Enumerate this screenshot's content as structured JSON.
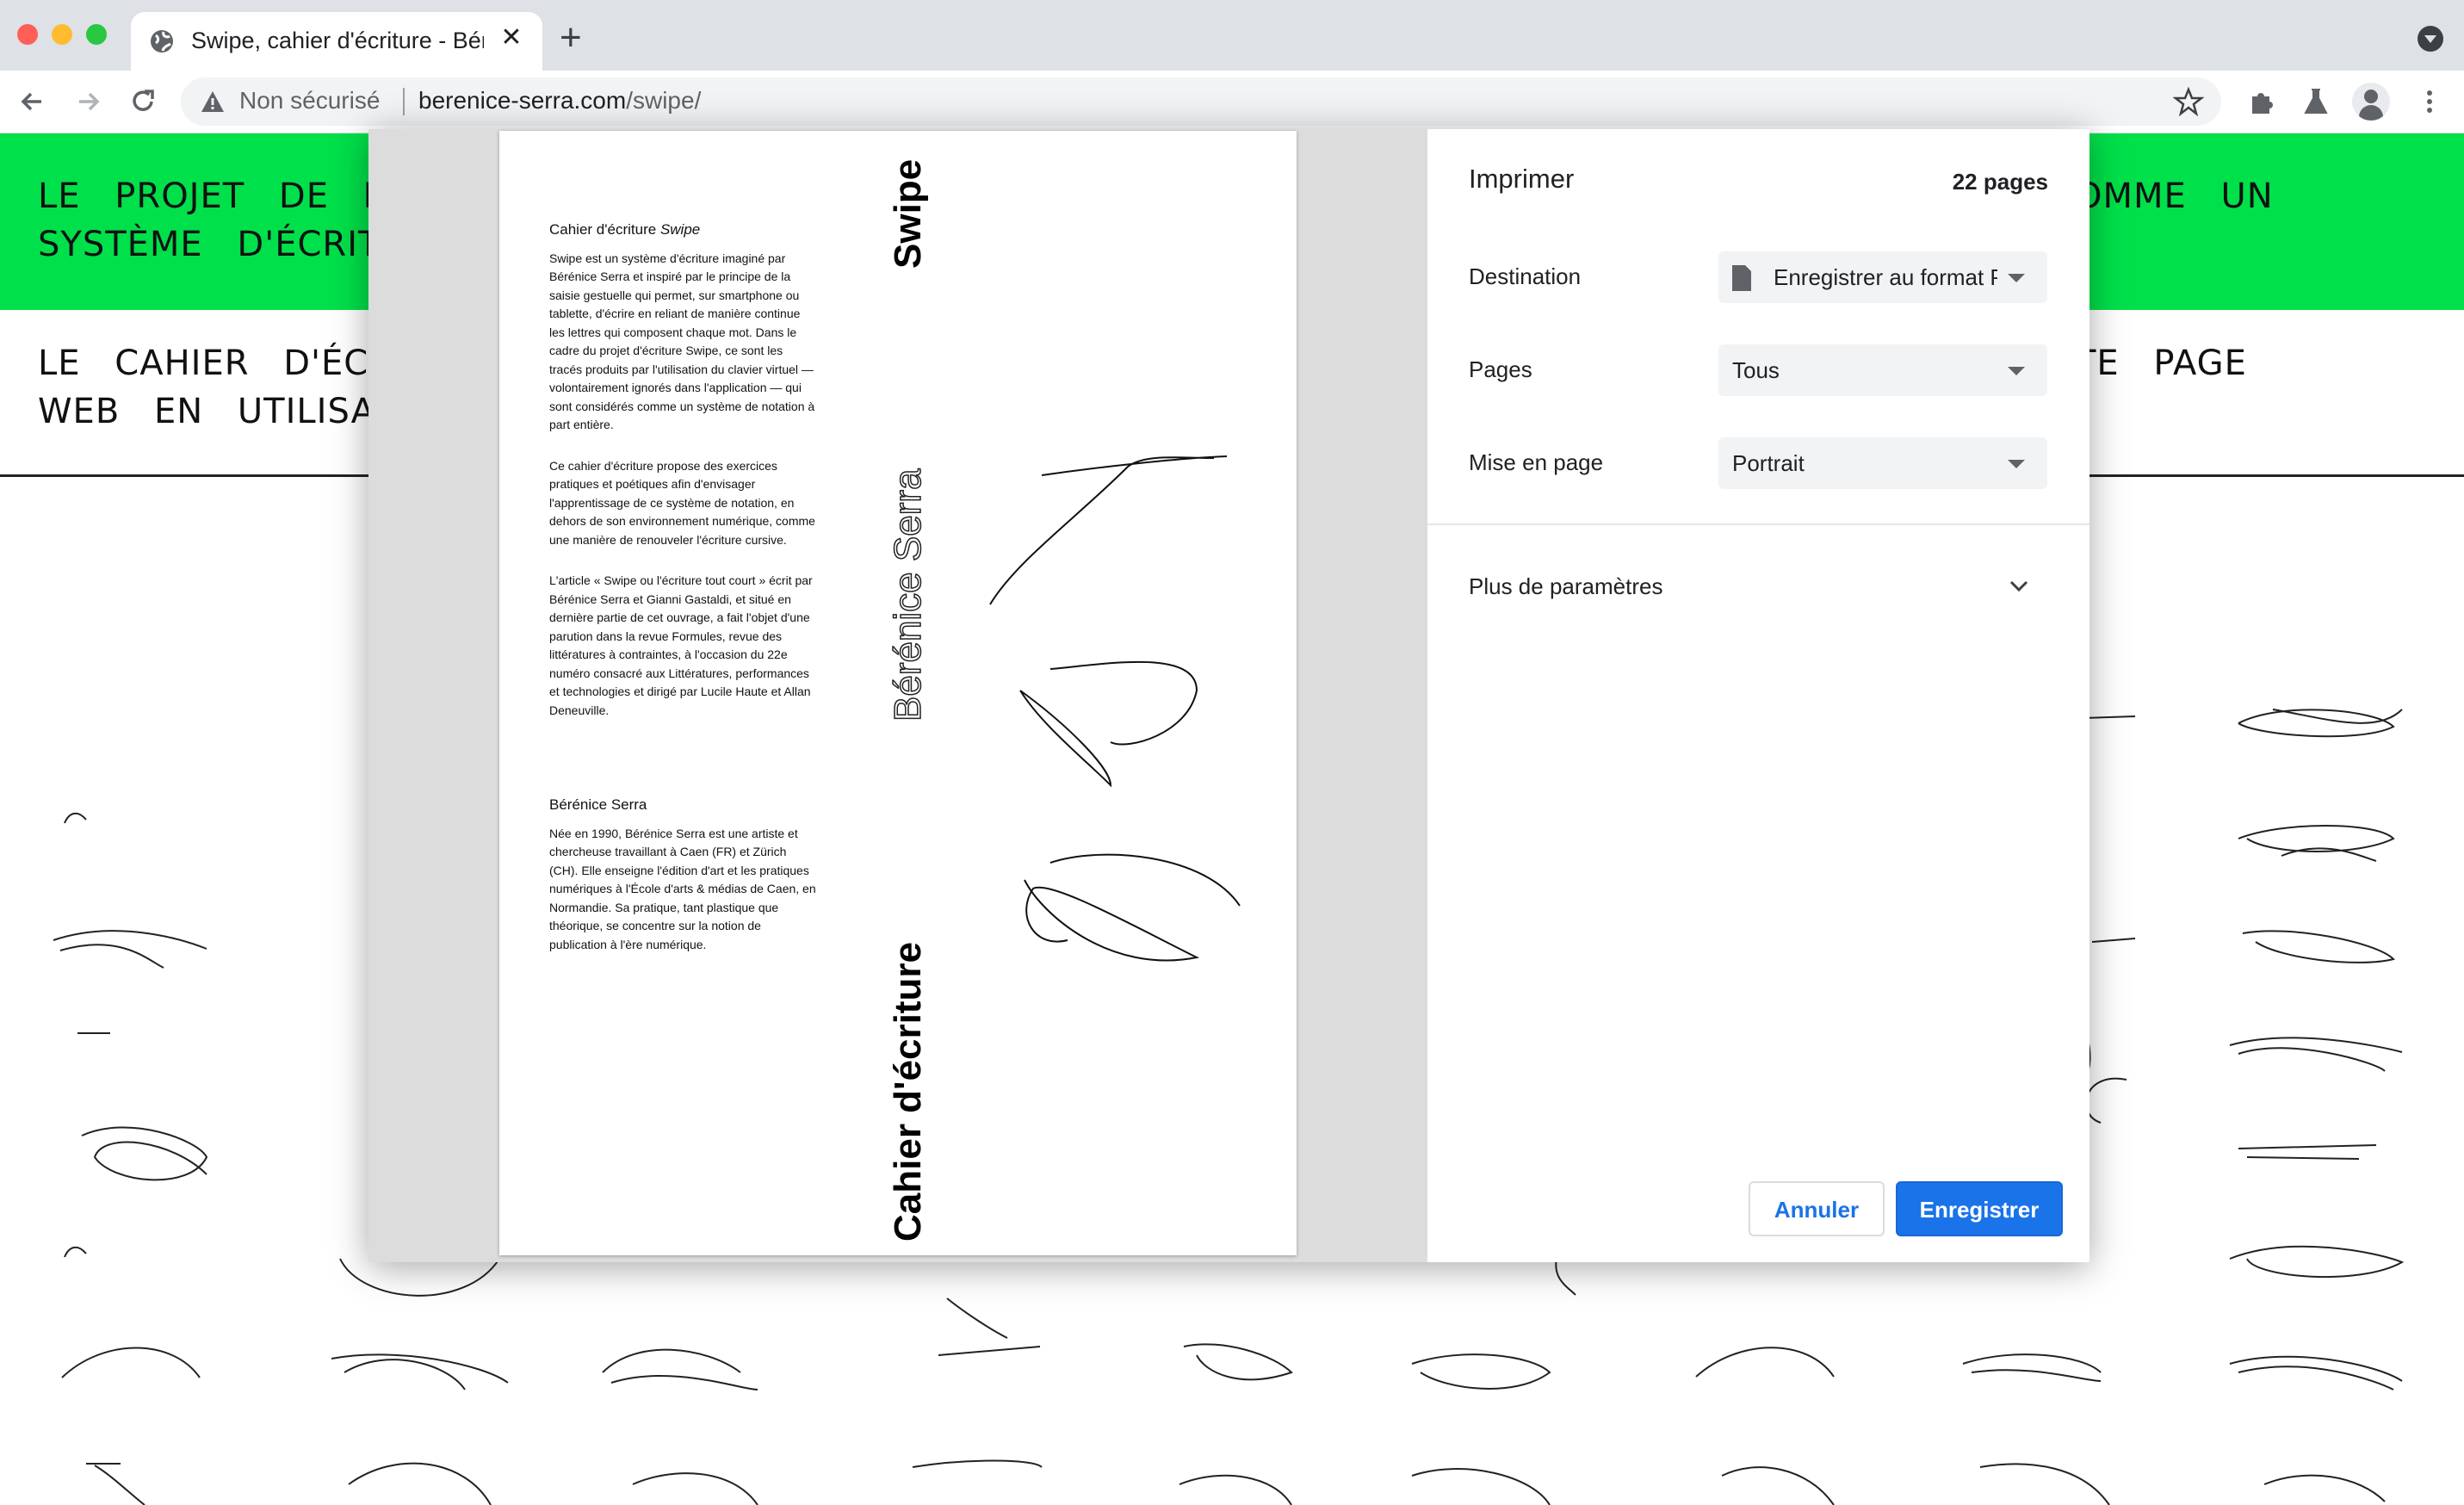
{
  "browser": {
    "tab_title": "Swipe, cahier d'écriture - Bérénice Serra",
    "security_label": "Non sécurisé",
    "url_host": "berenice-serra.com",
    "url_path": "/swipe/",
    "icons": [
      "globe-icon",
      "close-icon",
      "plus-icon",
      "back-icon",
      "forward-icon",
      "reload-icon",
      "warning-icon",
      "star-icon",
      "puzzle-icon",
      "flask-icon",
      "avatar-icon",
      "menu-icon"
    ]
  },
  "page": {
    "header_line1_left": "LE PROJET DE RE",
    "header_line2_left": "SYSTÈME D'ÉCRITU",
    "header_line1_right": "OMME UN",
    "subheader_line1_left": "LE CAHIER D'ÉCRIT",
    "subheader_line2_left": "WEB EN UTILISANT",
    "subheader_line1_right": "TE PAGE",
    "accent_color": "#00e04a"
  },
  "preview": {
    "intro_heading": "Cahier d'écriture",
    "intro_heading_em": "Swipe",
    "para1": "Swipe est un système d'écriture imaginé par Bérénice Serra et inspiré par le principe de la saisie gestuelle qui permet, sur smartphone ou tablette, d'écrire en reliant de manière continue les lettres qui composent chaque mot. Dans le cadre du projet d'écriture Swipe, ce sont les tracés produits par l'utilisation du clavier virtuel — volontairement ignorés dans l'application — qui sont considérés comme un système de notation à part entière.",
    "para2": "Ce cahier d'écriture propose des exercices pratiques et poétiques afin d'envisager l'apprentissage de ce système de notation, en dehors de son environnement numérique, comme une manière de renouveler l'écriture cursive.",
    "para3": "L'article « Swipe ou l'écriture tout court » écrit par Bérénice Serra et Gianni Gastaldi, et situé en dernière partie de cet ouvrage, a fait l'objet d'une parution dans la revue Formules, revue des littératures à contraintes, à l'occasion du 22e numéro consacré aux Littératures, performances et technologies et dirigé par Lucile Haute et Allan Deneuville.",
    "bio_heading": "Bérénice Serra",
    "bio": "Née en 1990, Bérénice Serra est une artiste et chercheuse travaillant à Caen (FR) et Zürich (CH). Elle enseigne l'édition d'art et les pratiques numériques à l'École d'arts & médias de Caen, en Normandie. Sa pratique, tant plastique que théorique, se concentre sur la notion de publication à l'ère numérique.",
    "vertical_title": "Swipe",
    "vertical_author": "Bérénice Serra",
    "vertical_subtitle": "Cahier d'écriture"
  },
  "print": {
    "title": "Imprimer",
    "page_count": "22 pages",
    "destination_label": "Destination",
    "destination_value": "Enregistrer au format PDF",
    "pages_label": "Pages",
    "pages_value": "Tous",
    "layout_label": "Mise en page",
    "layout_value": "Portrait",
    "more_settings": "Plus de paramètres",
    "cancel": "Annuler",
    "save": "Enregistrer",
    "primary_color": "#1a73e8"
  }
}
